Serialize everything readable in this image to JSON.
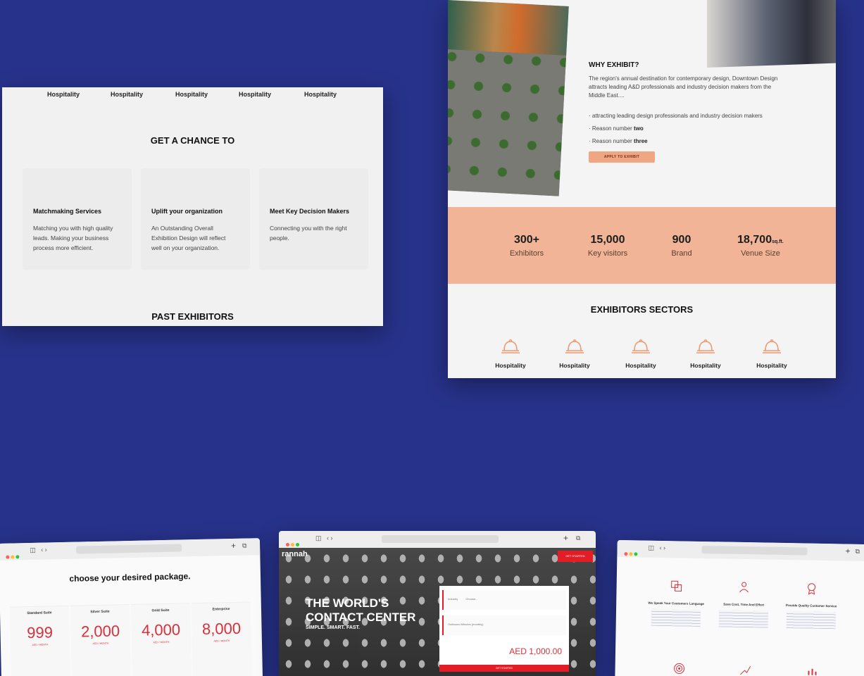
{
  "card1": {
    "nav": [
      "Hospitality",
      "Hospitality",
      "Hospitality",
      "Hospitality",
      "Hospitality"
    ],
    "title": "GET A CHANCE TO",
    "boxes": [
      {
        "title": "Matchmaking Services",
        "text": "Matching you with high quality leads. Making your business process more efficient."
      },
      {
        "title": "Uplift your organization",
        "text": "An Outstanding Overall Exhibition Design will reflect well on your organization."
      },
      {
        "title": "Meet Key Decision Makers",
        "text": "Connecting you with the right people."
      }
    ],
    "past": "PAST EXHIBITORS"
  },
  "card2": {
    "why_title": "WHY EXHIBIT?",
    "why_text": "The region's annual destination for contemporary design, Downtown Design attracts leading A&D professionals and industry decision makers from the Middle East....",
    "reasons": [
      {
        "prefix": "· attracting leading design professionals and industry decision makers",
        "bold": ""
      },
      {
        "prefix": "· Reason number ",
        "bold": "two"
      },
      {
        "prefix": "· Reason number ",
        "bold": "three"
      }
    ],
    "apply_button": "APPLY TO EXHIBIT",
    "stats": [
      {
        "number": "300+",
        "unit": "",
        "label": "Exhibitors"
      },
      {
        "number": "15,000",
        "unit": "",
        "label": "Key visitors"
      },
      {
        "number": "900",
        "unit": "",
        "label": "Brand"
      },
      {
        "number": "18,700",
        "unit": "sq.ft.",
        "label": "Venue Size"
      }
    ],
    "sectors_title": "EXHIBITORS SECTORS",
    "sectors": [
      "Hospitality",
      "Hospitality",
      "Hospitality",
      "Hospitality",
      "Hospitality"
    ],
    "accent_color": "#f1b496"
  },
  "window1": {
    "heading": "choose your desired package.",
    "packages": [
      {
        "name": "Standard Suite",
        "price": "999",
        "period": "AED / MONTH"
      },
      {
        "name": "Silver Suite",
        "price": "2,000",
        "period": "AED / MONTH"
      },
      {
        "name": "Gold Suite",
        "price": "4,000",
        "period": "AED / MONTH"
      },
      {
        "name": "Enterprise",
        "price": "8,000",
        "period": "AED / MONTH"
      }
    ]
  },
  "window2": {
    "logo": "rannah",
    "top_button": "GET STARTED",
    "hero_line1": "THE WORLD'S",
    "hero_line2": "CONTACT CENTER",
    "subtitle": "SIMPLE. SMART. FAST.",
    "field1_label": "Industry",
    "field1_value": "Choose...",
    "field2_label": "Outbound Minutes (monthly)",
    "amount": "AED 1,000.00",
    "get_button": "GET STARTED",
    "accent_color": "#e21d27"
  },
  "window3": {
    "features": [
      {
        "title": "We Speak Your Customers Language",
        "icon": "translate-icon"
      },
      {
        "title": "Save Cost, Time And Effort",
        "icon": "person-icon"
      },
      {
        "title": "Provide Quality Customer Service",
        "icon": "badge-icon"
      }
    ]
  },
  "background_color": "#27328a"
}
